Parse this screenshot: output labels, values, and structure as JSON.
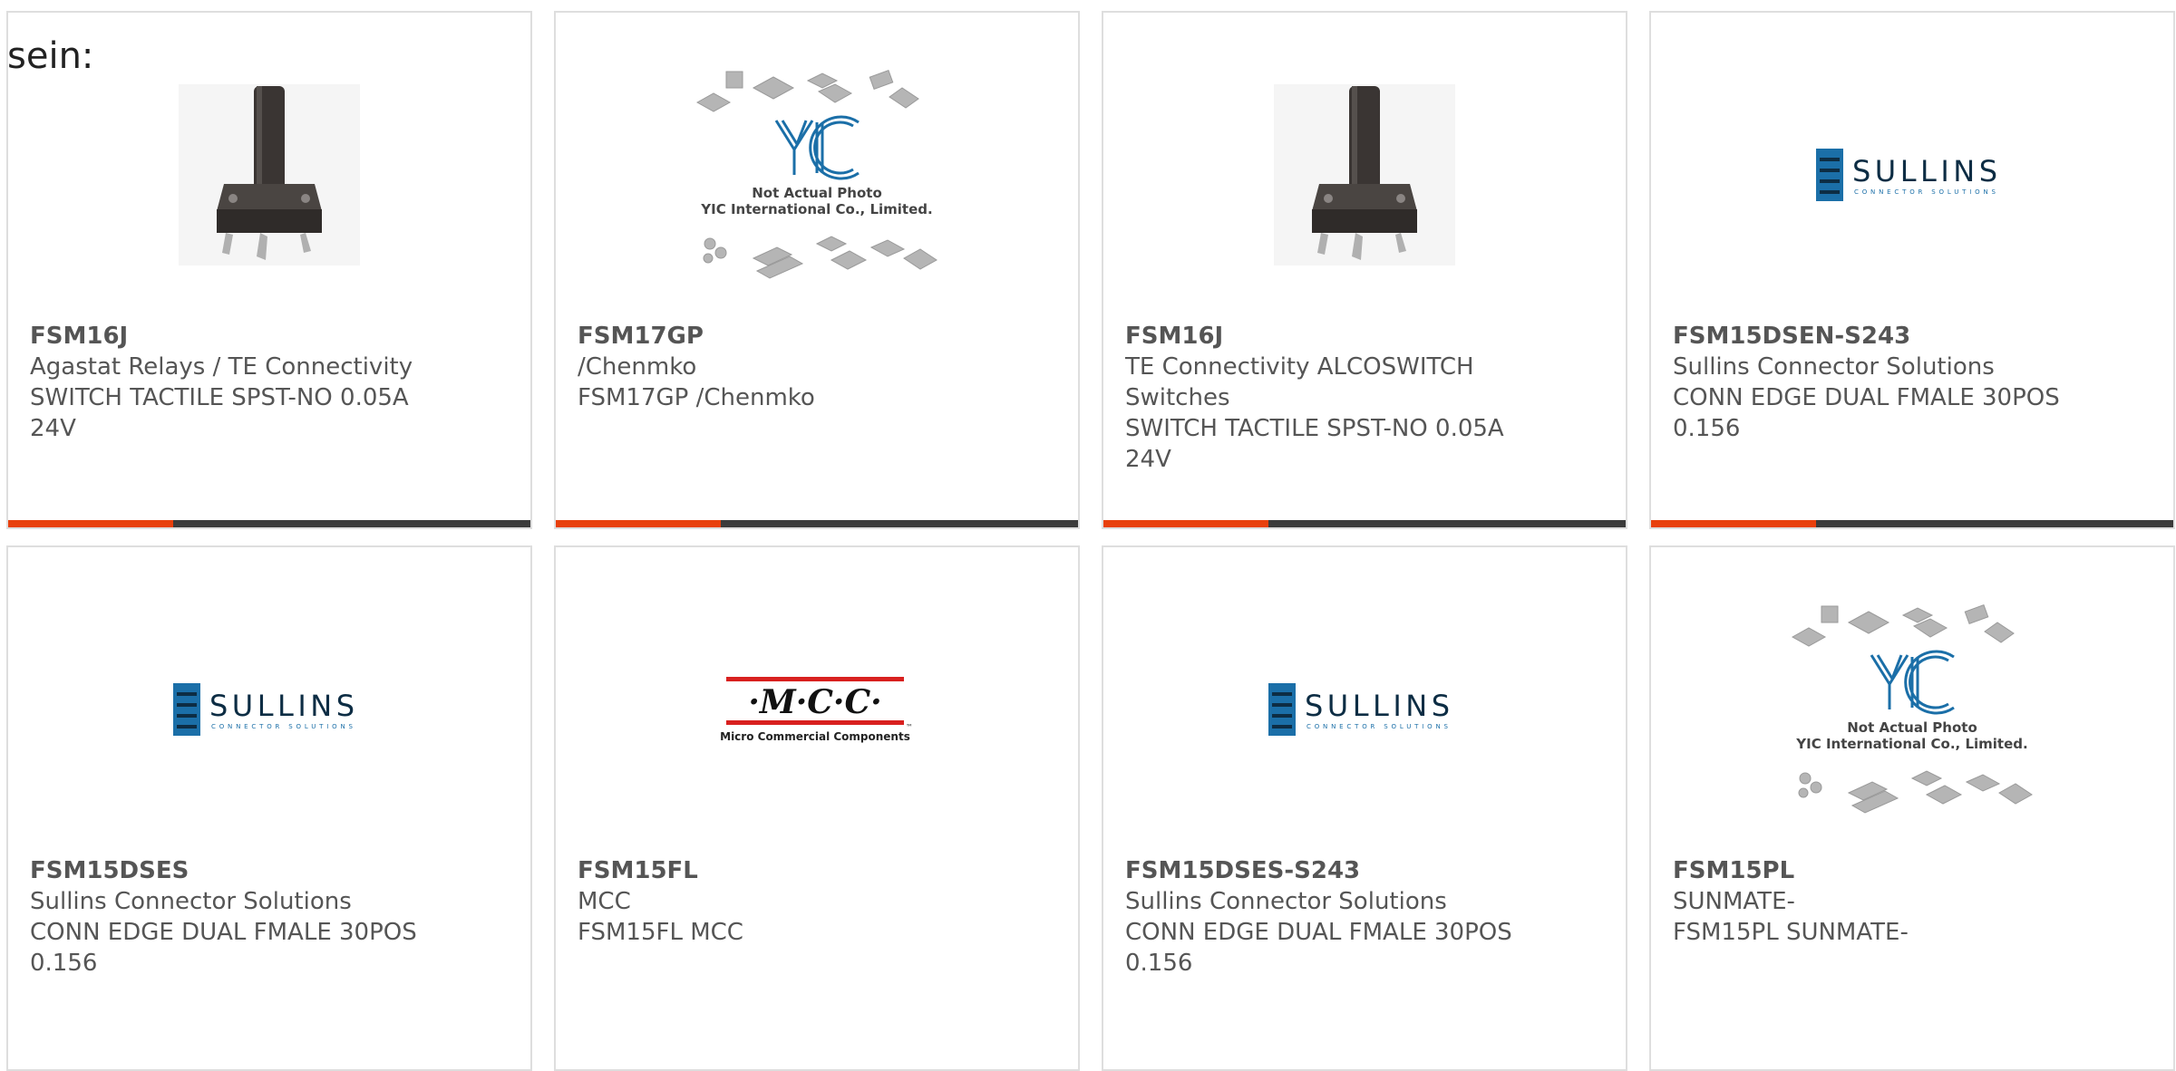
{
  "lead_text": "sein:",
  "colors": {
    "accent": "#e8400c",
    "bar_dark": "#3b3b3b",
    "card_border": "#dedede",
    "text": "#555555",
    "sullins_blue": "#1b6fa8",
    "mcc_red": "#d8201f"
  },
  "products": [
    {
      "part_number": "FSM16J",
      "lines": [
        "Agastat Relays / TE Connectivity",
        "SWITCH TACTILE SPST-NO 0.05A",
        "24V"
      ],
      "image": "tactile-switch-photo",
      "has_accent_bar": true
    },
    {
      "part_number": "FSM17GP",
      "lines": [
        "/Chenmko",
        "FSM17GP /Chenmko"
      ],
      "image": "yic-placeholder-logo",
      "image_text": [
        "Not Actual Photo",
        "YIC International Co., Limited."
      ],
      "has_accent_bar": true
    },
    {
      "part_number": "FSM16J",
      "lines": [
        "TE Connectivity ALCOSWITCH",
        "Switches",
        "SWITCH TACTILE SPST-NO 0.05A",
        "24V"
      ],
      "image": "tactile-switch-photo",
      "has_accent_bar": true
    },
    {
      "part_number": "FSM15DSEN-S243",
      "lines": [
        "Sullins Connector Solutions",
        "CONN EDGE DUAL FMALE 30POS",
        "0.156"
      ],
      "image": "sullins-logo",
      "image_text": [
        "SULLINS",
        "CONNECTOR SOLUTIONS"
      ],
      "has_accent_bar": true
    },
    {
      "part_number": "FSM15DSES",
      "lines": [
        "Sullins Connector Solutions",
        "CONN EDGE DUAL FMALE 30POS",
        "0.156"
      ],
      "image": "sullins-logo",
      "image_text": [
        "SULLINS",
        "CONNECTOR SOLUTIONS"
      ],
      "has_accent_bar": false
    },
    {
      "part_number": "FSM15FL",
      "lines": [
        "MCC",
        "FSM15FL MCC"
      ],
      "image": "mcc-logo",
      "image_text": [
        "·M·C·C·",
        "Micro Commercial Components",
        "™"
      ],
      "has_accent_bar": false
    },
    {
      "part_number": "FSM15DSES-S243",
      "lines": [
        "Sullins Connector Solutions",
        "CONN EDGE DUAL FMALE 30POS",
        "0.156"
      ],
      "image": "sullins-logo",
      "image_text": [
        "SULLINS",
        "CONNECTOR SOLUTIONS"
      ],
      "has_accent_bar": false
    },
    {
      "part_number": "FSM15PL",
      "lines": [
        "SUNMATE-",
        "FSM15PL SUNMATE-"
      ],
      "image": "yic-placeholder-logo",
      "image_text": [
        "Not Actual Photo",
        "YIC International Co., Limited."
      ],
      "has_accent_bar": false
    }
  ]
}
